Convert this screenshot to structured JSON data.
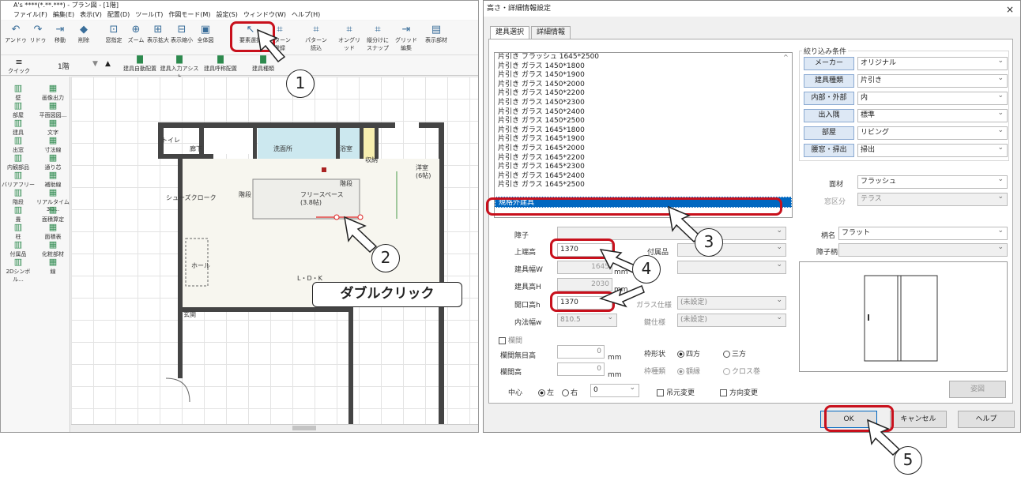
{
  "left_window": {
    "title": "A's ****(*.**.***) - プラン図 - [1階]",
    "menu": [
      "ファイル(F)",
      "編集(E)",
      "表示(V)",
      "配置(D)",
      "ツール(T)",
      "作図モード(M)",
      "設定(S)",
      "ウィンドウ(W)",
      "ヘルプ(H)"
    ],
    "toolbar": [
      "アンドゥ",
      "リドゥ",
      "移動",
      "削除",
      "窓指定",
      "ズーム",
      "表示拡大",
      "表示縮小",
      "全体図",
      "要素選択",
      "パターン登録",
      "パターン読込",
      "オングリッド",
      "縦分けにスナップ",
      "グリッド編集",
      "表示部材"
    ],
    "quick_menu": "クイックメニュー",
    "floor": "1階",
    "sub_toolbar": [
      "建具自動配置",
      "建具入力アシスト",
      "建具呼称配置",
      "建具種類"
    ],
    "sidebar": [
      "壁",
      "画像出力",
      "部屋",
      "平面図図...",
      "建具",
      "文字",
      "出窓",
      "寸法線",
      "内観部品",
      "通り芯",
      "バリアフリー",
      "補助線",
      "階段",
      "リアルタイム3D...",
      "畳",
      "面積算定",
      "柱",
      "面積表",
      "付属品",
      "化粧部材",
      "2Dシンボル...",
      "線"
    ],
    "rooms": [
      "トイレ",
      "廊下",
      "洗面所",
      "浴室",
      "収納",
      "洋室",
      "(6帖)",
      "シューズクローク",
      "階段",
      "フリースペース",
      "(3.8帖)",
      "階段",
      "ホール",
      "L・D・K",
      "玄関"
    ]
  },
  "dialog": {
    "title": "高さ・詳細情報設定",
    "close": "×",
    "tabs": [
      "建具選択",
      "詳細情報"
    ],
    "list": [
      "片引き フラッシュ 1645*2500",
      "片引き ガラス 1450*1800",
      "片引き ガラス 1450*1900",
      "片引き ガラス 1450*2000",
      "片引き ガラス 1450*2200",
      "片引き ガラス 1450*2300",
      "片引き ガラス 1450*2400",
      "片引き ガラス 1450*2500",
      "片引き ガラス 1645*1800",
      "片引き ガラス 1645*1900",
      "片引き ガラス 1645*2000",
      "片引き ガラス 1645*2200",
      "片引き ガラス 1645*2300",
      "片引き ガラス 1645*2400",
      "片引き ガラス 1645*2500"
    ],
    "selected_item": "規格外建具",
    "filter": {
      "title": "絞り込み条件",
      "rows": [
        {
          "label": "メーカー",
          "value": "オリジナル"
        },
        {
          "label": "建具種類",
          "value": "片引き"
        },
        {
          "label": "内部・外部",
          "value": "内"
        },
        {
          "label": "出入隅",
          "value": "標準"
        },
        {
          "label": "部屋",
          "value": "リビング"
        },
        {
          "label": "腰窓・掃出",
          "value": "掃出"
        }
      ]
    },
    "face_material_label": "面材",
    "face_material_value": "フラッシュ",
    "window_class_label": "窓区分",
    "window_class_value": "テラス",
    "pattern_label": "柄名",
    "pattern_value": "フラット",
    "shoji_pattern_label": "障子柄",
    "shoji_label": "障子",
    "top_height_label": "上端高",
    "top_height_value": "1370",
    "fitting_width_label": "建具幅W",
    "fitting_width_value": "1645",
    "fitting_height_label": "建具高H",
    "fitting_height_value": "2030",
    "opening_height_label": "開口高h",
    "opening_height_value": "1370",
    "inner_width_label": "内法幅w",
    "inner_width_value": "810.5",
    "accessory_label": "付属品",
    "glass_spec_label": "ガラス仕様",
    "glass_spec_value": "(未設定)",
    "key_spec_label": "鍵仕様",
    "key_spec_value": "(未設定)",
    "unit_mm": "mm",
    "ranma_label": "欄間",
    "ranma_no_height_label": "欄間無目高",
    "ranma_no_height_value": "0",
    "ranma_height_label": "欄間高",
    "ranma_height_value": "0",
    "frame_shape_label": "枠形状",
    "frame_four": "四方",
    "frame_three": "三方",
    "frame_type_label": "枠種類",
    "frame_gakuenu": "額縁",
    "frame_cloth": "クロス巻",
    "center_label": "中心",
    "left_label": "左",
    "right_label": "右",
    "center_value": "0",
    "hang_change": "吊元変更",
    "direction_change": "方向変更",
    "elevation_button": "姿図",
    "ok": "OK",
    "cancel": "キャンセル",
    "help": "ヘルプ"
  },
  "annotations": {
    "double_click": "ダブルクリック",
    "steps": [
      "1",
      "2",
      "3",
      "4",
      "5"
    ],
    "highlight_color": "#c8101c"
  }
}
